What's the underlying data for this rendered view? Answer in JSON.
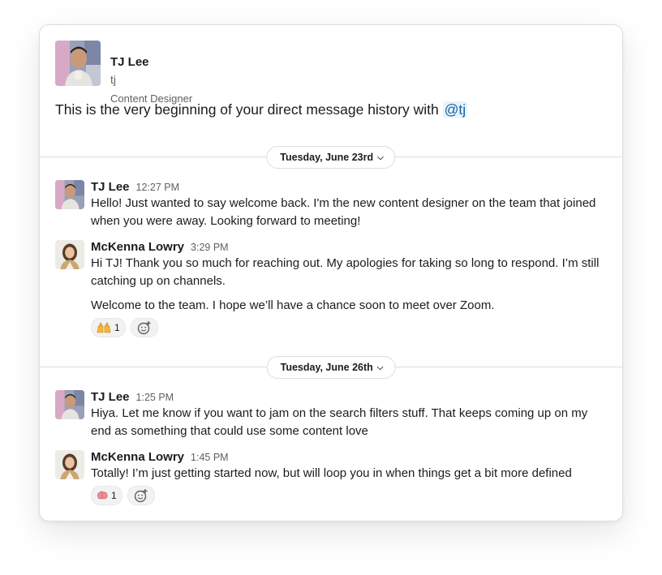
{
  "header": {
    "name": "TJ Lee",
    "handle": "tj",
    "title": "Content Designer",
    "intro_text": "This is the very beginning of your direct message history with ",
    "mention": "@tj"
  },
  "sections": [
    {
      "date_label": "Tuesday, June 23rd",
      "messages": [
        {
          "sender": "TJ Lee",
          "time": "12:27 PM",
          "text": "Hello! Just wanted to say welcome back. I'm the new content designer on the team that joined when you were away. Looking forward to meeting!"
        },
        {
          "sender": "McKenna Lowry",
          "time": "3:29 PM",
          "text": "Hi TJ! Thank you so much for reaching out. My apologies for taking so long to respond. I’m still catching up on channels.",
          "text2": "Welcome to the team. I hope we’ll have a chance soon to meet over Zoom.",
          "reaction": {
            "emoji": "raised-hands-icon",
            "count": "1"
          }
        }
      ]
    },
    {
      "date_label": "Tuesday, June 26th",
      "messages": [
        {
          "sender": "TJ Lee",
          "time": "1:25 PM",
          "text": "Hiya. Let me know if you want to jam on the search filters stuff. That keeps coming up on my end as something that could use some content love"
        },
        {
          "sender": "McKenna Lowry",
          "time": "1:45 PM",
          "text": "Totally! I’m just getting started now, but will loop you in when things get a bit more defined",
          "reaction": {
            "emoji": "brain-icon",
            "count": "1"
          }
        }
      ]
    }
  ],
  "colors": {
    "mention_bg": "#e8f3fb",
    "mention_fg": "#1264a3",
    "divider": "#dddddd",
    "muted_text": "#616061"
  }
}
